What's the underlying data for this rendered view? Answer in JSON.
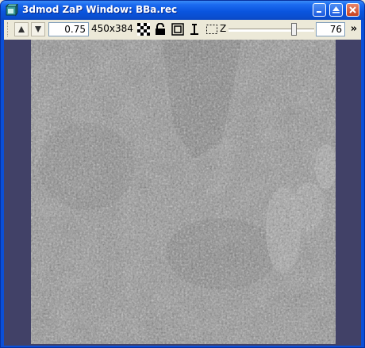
{
  "window": {
    "title": "3dmod ZaP Window: BBa.rec",
    "icon": "3dmod-app-icon",
    "buttons": {
      "minimize": "minimize-icon",
      "maximize": "maximize-icon",
      "close": "close-icon"
    }
  },
  "toolbar": {
    "zoom_down": "arrow-up-icon",
    "zoom_up": "arrow-down-icon",
    "zoom_value": "0.75",
    "image_size": "450x384",
    "icons": [
      "interpolation-checker-icon",
      "lock-icon",
      "center-box-icon",
      "insert-point-icon",
      "rubberband-icon"
    ],
    "z_label": "Z",
    "z_value": "76",
    "z_slider_level": 0.82,
    "more": "»"
  },
  "image": {
    "description_icon": "tomogram-slice",
    "background_color": "#414167"
  }
}
